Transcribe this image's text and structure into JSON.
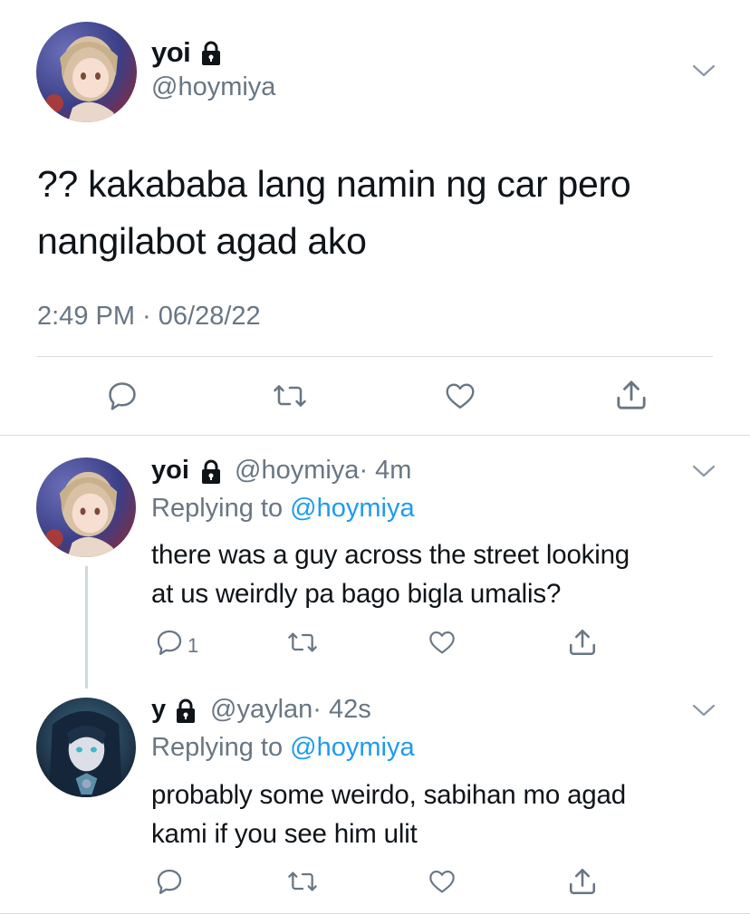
{
  "main_tweet": {
    "display_name": "yoi",
    "handle": "@hoymiya",
    "text": "?? kakababa lang namin ng car pero nangilabot agad ako",
    "timestamp": "2:49 PM · 06/28/22",
    "locked": true,
    "actions": [
      "reply-icon",
      "retweet-icon",
      "like-icon",
      "share-icon"
    ]
  },
  "replies": [
    {
      "display_name": "yoi",
      "handle": "@hoymiya",
      "time": "· 4m",
      "replying_prefix": "Replying to",
      "replying_handle": "@hoymiya",
      "text_line1": "there was a guy across the street looking",
      "text_line2": "at us weirdly pa bago bigla umalis?",
      "reply_count": "1",
      "locked": true
    },
    {
      "display_name": "y",
      "handle": "@yaylan",
      "time": "· 42s",
      "replying_prefix": "Replying to",
      "replying_handle": "@hoymiya",
      "text_line1": "probably some weirdo, sabihan mo agad",
      "text_line2": "kami if you see him ulit",
      "reply_count": "",
      "locked": true
    }
  ],
  "colors": {
    "text": "#0f1419",
    "secondary": "#687684",
    "link": "#1d9bf0",
    "divider": "#d6dbe0"
  }
}
